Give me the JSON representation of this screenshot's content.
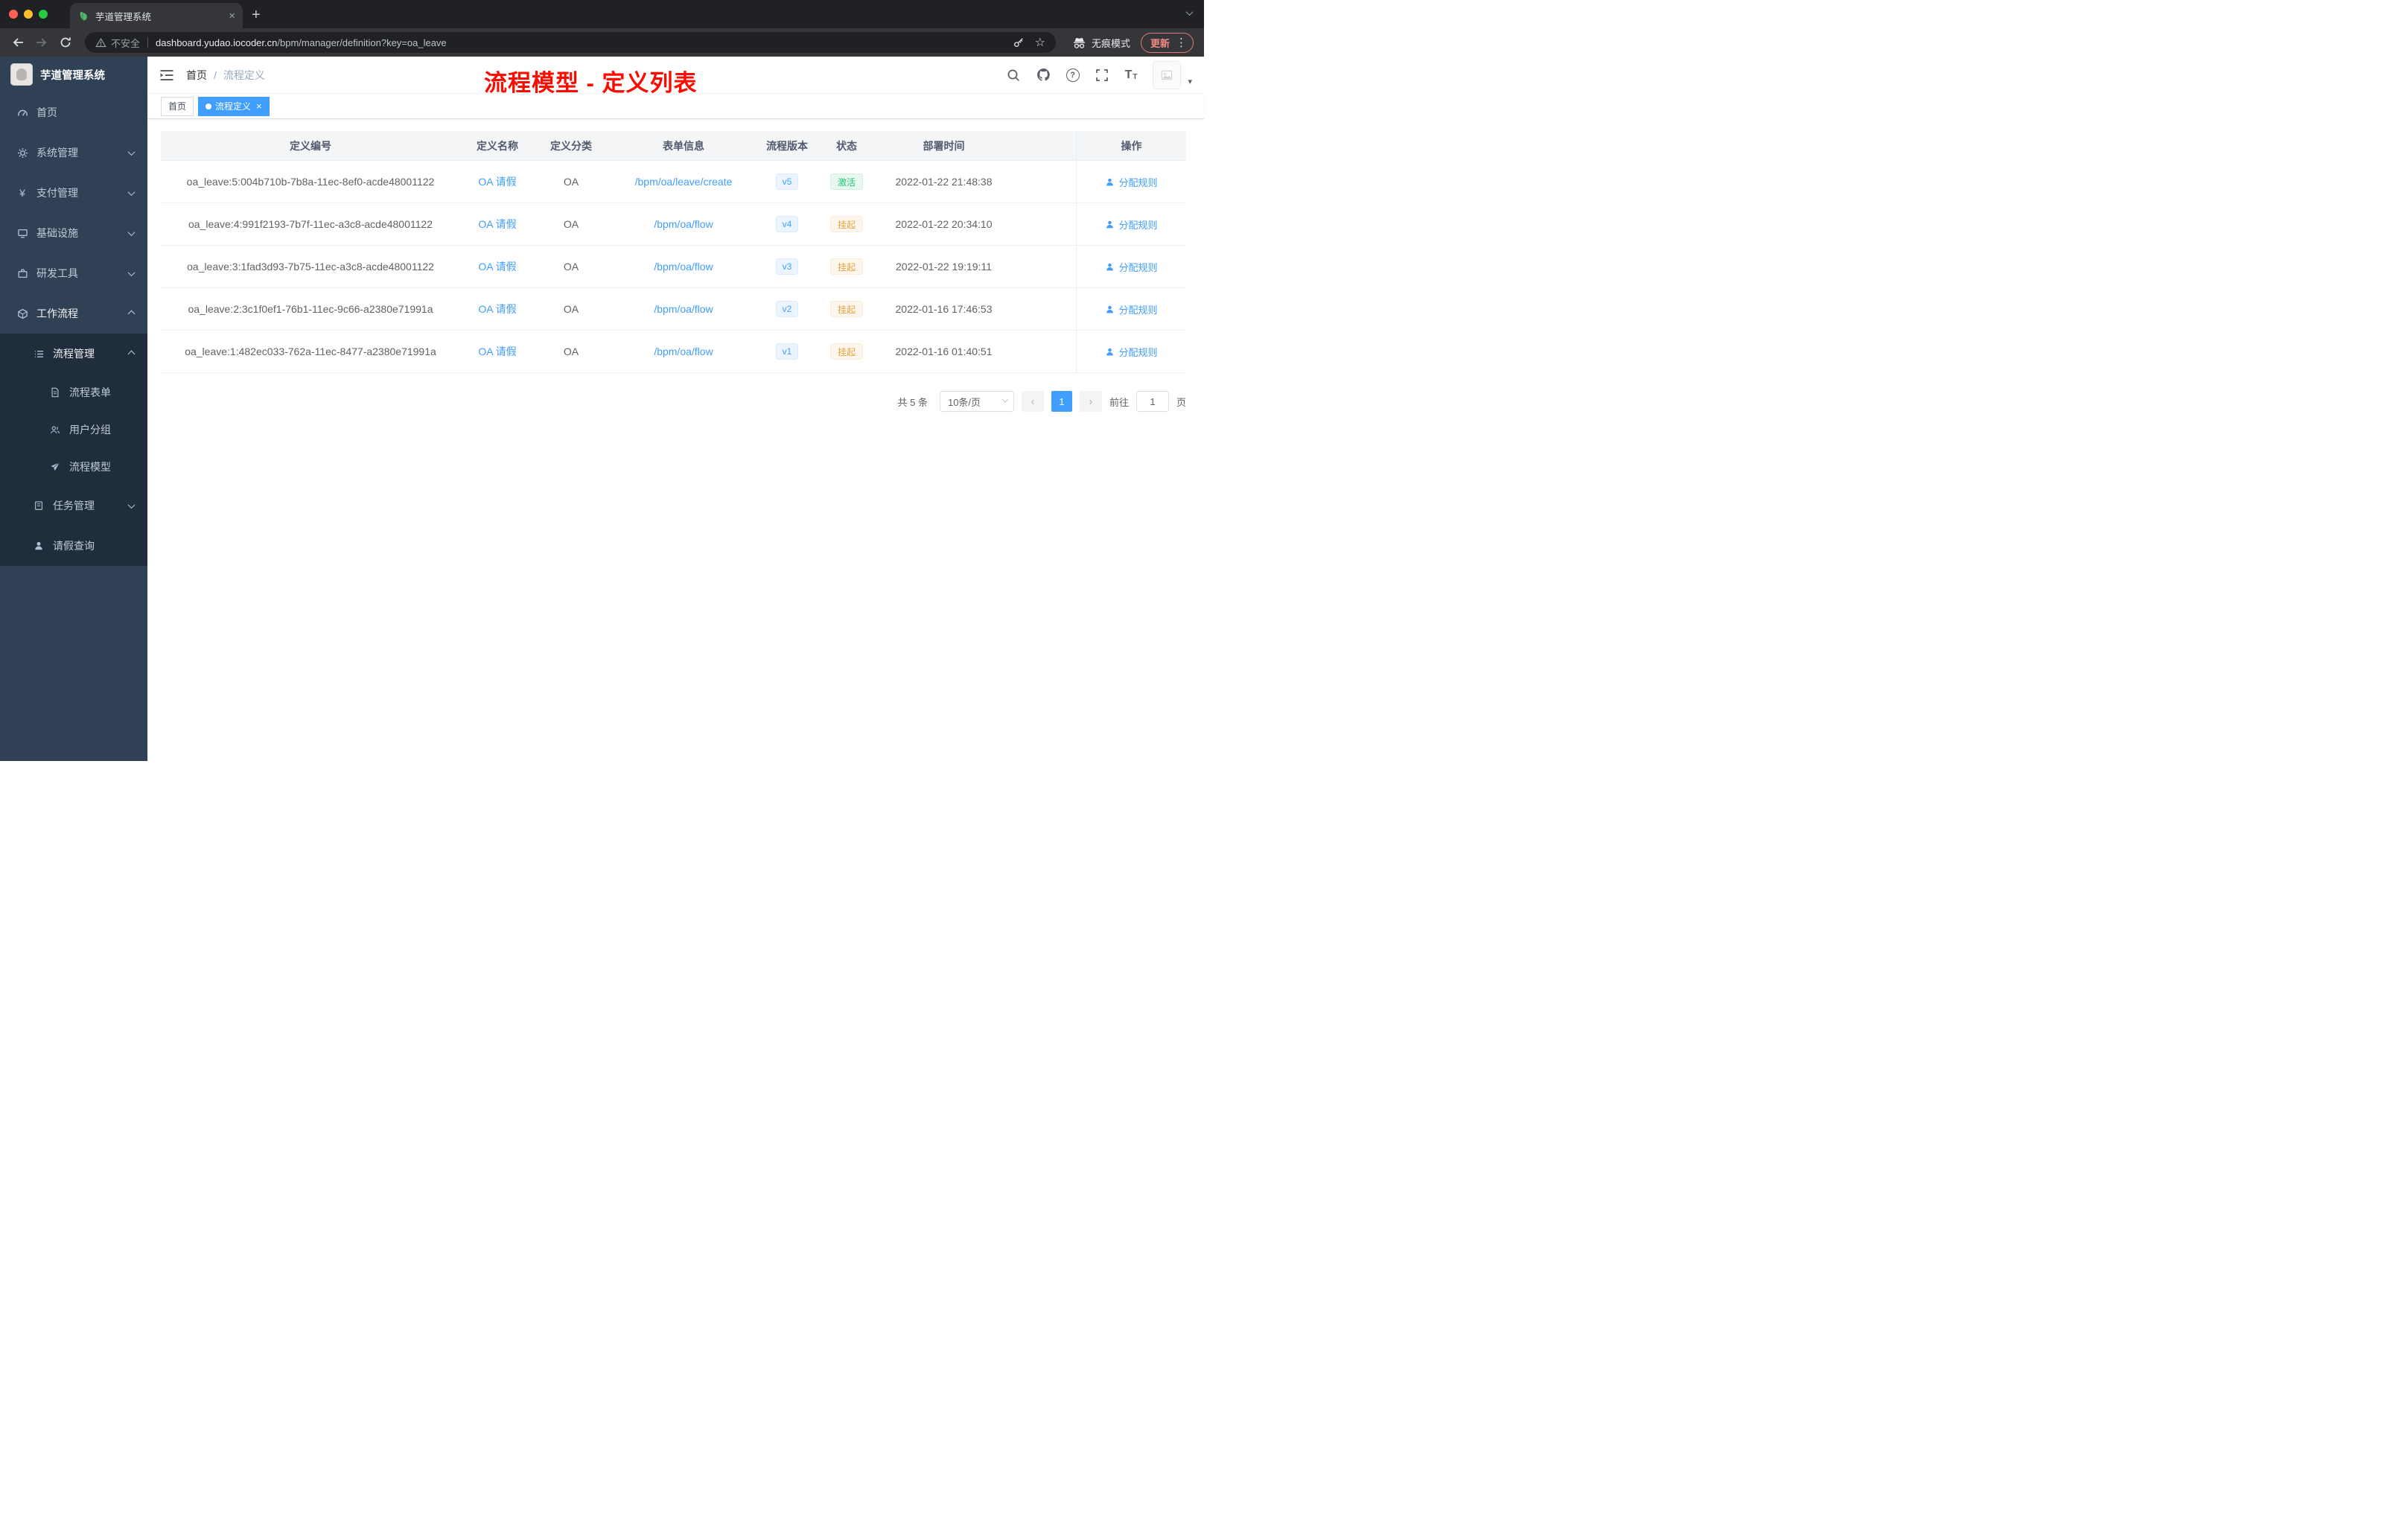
{
  "browser": {
    "tab": {
      "title": "芋道管理系统"
    },
    "address": {
      "security_label": "不安全",
      "domain": "dashboard.yudao.iocoder.cn",
      "path": "/bpm/manager/definition?key=oa_leave"
    },
    "incognito_label": "无痕模式",
    "update_label": "更新"
  },
  "icons": {
    "close": "×",
    "plus": "+",
    "star": "☆",
    "dots": "⋮",
    "question": "?",
    "font_size": "T",
    "yen": "¥",
    "angle_left": "‹",
    "angle_right": "›",
    "caret_down": "▾"
  },
  "sidebar": {
    "brand": "芋道管理系统",
    "items": [
      {
        "label": "首页"
      },
      {
        "label": "系统管理"
      },
      {
        "label": "支付管理"
      },
      {
        "label": "基础设施"
      },
      {
        "label": "研发工具"
      },
      {
        "label": "工作流程"
      }
    ],
    "workflow_children": [
      {
        "label": "流程管理"
      },
      {
        "label": "流程表单"
      },
      {
        "label": "用户分组"
      },
      {
        "label": "流程模型"
      },
      {
        "label": "任务管理"
      },
      {
        "label": "请假查询"
      }
    ]
  },
  "navbar": {
    "breadcrumb": {
      "home": "首页",
      "sep": "/",
      "current": "流程定义"
    },
    "annotation": "流程模型 - 定义列表"
  },
  "tags": [
    {
      "label": "首页"
    },
    {
      "label": "流程定义"
    }
  ],
  "table": {
    "columns": [
      "定义编号",
      "定义名称",
      "定义分类",
      "表单信息",
      "流程版本",
      "状态",
      "部署时间",
      "操作"
    ],
    "rows": [
      {
        "id": "oa_leave:5:004b710b-7b8a-11ec-8ef0-acde48001122",
        "name": "OA 请假",
        "category": "OA",
        "form": "/bpm/oa/leave/create",
        "version": "v5",
        "status": "激活",
        "deploy_time": "2022-01-22 21:48:38",
        "action": "分配规则"
      },
      {
        "id": "oa_leave:4:991f2193-7b7f-11ec-a3c8-acde48001122",
        "name": "OA 请假",
        "category": "OA",
        "form": "/bpm/oa/flow",
        "version": "v4",
        "status": "挂起",
        "deploy_time": "2022-01-22 20:34:10",
        "action": "分配规则"
      },
      {
        "id": "oa_leave:3:1fad3d93-7b75-11ec-a3c8-acde48001122",
        "name": "OA 请假",
        "category": "OA",
        "form": "/bpm/oa/flow",
        "version": "v3",
        "status": "挂起",
        "deploy_time": "2022-01-22 19:19:11",
        "action": "分配规则"
      },
      {
        "id": "oa_leave:2:3c1f0ef1-76b1-11ec-9c66-a2380e71991a",
        "name": "OA 请假",
        "category": "OA",
        "form": "/bpm/oa/flow",
        "version": "v2",
        "status": "挂起",
        "deploy_time": "2022-01-16 17:46:53",
        "action": "分配规则"
      },
      {
        "id": "oa_leave:1:482ec033-762a-11ec-8477-a2380e71991a",
        "name": "OA 请假",
        "category": "OA",
        "form": "/bpm/oa/flow",
        "version": "v1",
        "status": "挂起",
        "deploy_time": "2022-01-16 01:40:51",
        "action": "分配规则"
      }
    ]
  },
  "pagination": {
    "total": "共 5 条",
    "page_size": "10条/页",
    "page": "1",
    "goto_label": "前往",
    "goto_value": "1",
    "goto_unit": "页"
  },
  "colors": {
    "accent": "#409eff",
    "status_active": "#1dc779",
    "status_suspended": "#e6a23c",
    "annotation_red": "#fb0b00",
    "sidebar_bg": "#304156",
    "submenu_bg": "#1f2d3d"
  }
}
